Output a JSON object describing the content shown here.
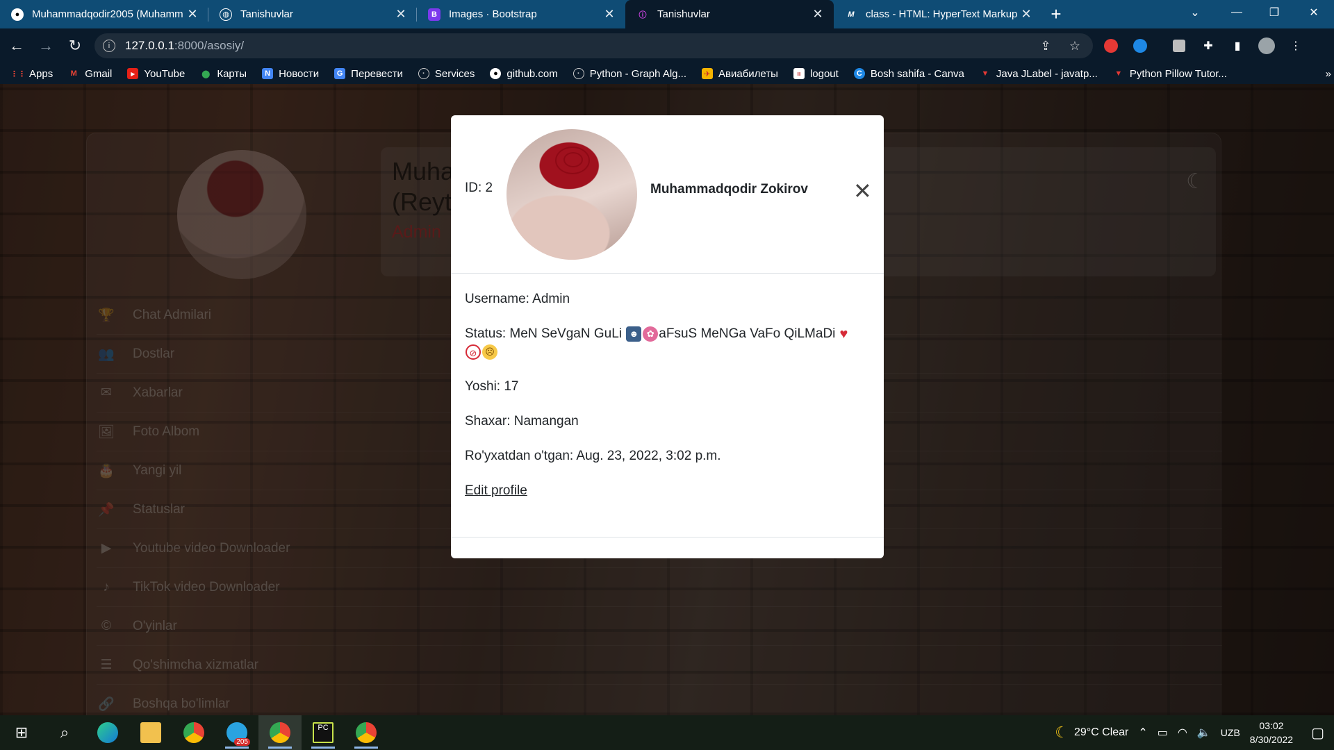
{
  "browser": {
    "tabs": [
      {
        "title": "Muhammadqodir2005 (Muhamm",
        "icon": "github-icon"
      },
      {
        "title": "Tanishuvlar",
        "icon": "globe-icon"
      },
      {
        "title": "Images · Bootstrap",
        "icon": "bootstrap-icon"
      },
      {
        "title": "Tanishuvlar",
        "icon": "site-icon",
        "active": true
      },
      {
        "title": "class - HTML: HyperText Markup",
        "icon": "mdn-icon"
      }
    ],
    "url_host": "127.0.0.1",
    "url_path": ":8000/asosiy/",
    "bookmarks": [
      "Apps",
      "Gmail",
      "YouTube",
      "Карты",
      "Новости",
      "Перевести",
      "Services",
      "github.com",
      "Python - Graph Alg...",
      "Авиабилеты",
      "logout",
      "Bosh sahifa - Canva",
      "Java JLabel - javatp...",
      "Python Pillow Tutor..."
    ],
    "bookmarks_overflow": "»"
  },
  "background_page": {
    "name_line1": "Muha",
    "name_line2": "(Reyti",
    "role": "Admin",
    "menu": [
      {
        "label": "Chat Admilari",
        "icon": "trophy-icon",
        "glyph": "🏆"
      },
      {
        "label": "Dostlar",
        "icon": "users-icon",
        "glyph": "👥"
      },
      {
        "label": "Xabarlar",
        "icon": "envelope-icon",
        "glyph": "✉"
      },
      {
        "label": "Foto Albom",
        "icon": "image-icon",
        "glyph": "🖼"
      },
      {
        "label": "Yangi yil",
        "icon": "cake-icon",
        "glyph": "🎂"
      },
      {
        "label": "Statuslar",
        "icon": "pin-icon",
        "glyph": "📌"
      },
      {
        "label": "Youtube video Downloader",
        "icon": "youtube-icon",
        "glyph": "▶"
      },
      {
        "label": "TikTok video Downloader",
        "icon": "tiktok-icon",
        "glyph": "♪"
      },
      {
        "label": "O'yinlar",
        "icon": "gamepad-icon",
        "glyph": "©"
      },
      {
        "label": "Qo'shimcha xizmatlar",
        "icon": "server-icon",
        "glyph": "☰"
      },
      {
        "label": "Boshqa bo'limlar",
        "icon": "link-icon",
        "glyph": "🔗"
      }
    ]
  },
  "modal": {
    "id_text": "ID: 2",
    "title": "Muhammadqodir Zokirov",
    "username": "Username: Admin",
    "status_text_1": "Status: MeN SeVgaN GuLi ",
    "status_text_2": "aFsuS MeNGa VaFo QiLMaDi",
    "yosh": "Yoshi: 17",
    "shaxar": "Shaxar: Namangan",
    "royxat": "Ro'yxatdan o'tgan: Aug. 23, 2022, 3:02 p.m.",
    "edit_link": "Edit profile"
  },
  "taskbar": {
    "telegram_badge": "205",
    "weather": "29°C  Clear",
    "lang": "UZB",
    "time": "03:02",
    "date": "8/30/2022"
  }
}
